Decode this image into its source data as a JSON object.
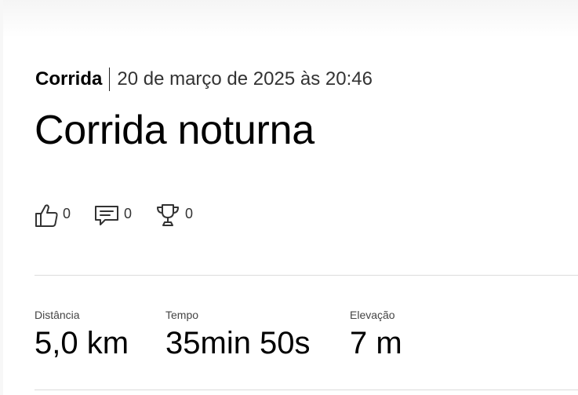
{
  "activity": {
    "sport": "Corrida",
    "date": "20 de março de 2025 às 20:46",
    "title": "Corrida noturna"
  },
  "reactions": {
    "kudos": {
      "icon": "thumbs-up-icon",
      "count": "0"
    },
    "comments": {
      "icon": "comment-icon",
      "count": "0"
    },
    "achievements": {
      "icon": "trophy-icon",
      "count": "0"
    }
  },
  "stats": [
    {
      "label": "Distância",
      "value": "5,0 km"
    },
    {
      "label": "Tempo",
      "value": "35min 50s"
    },
    {
      "label": "Elevação",
      "value": "7 m"
    }
  ],
  "colors": {
    "background": "#ffffff",
    "text": "#000000",
    "muted": "#333333",
    "divider": "#dcdcdc"
  }
}
